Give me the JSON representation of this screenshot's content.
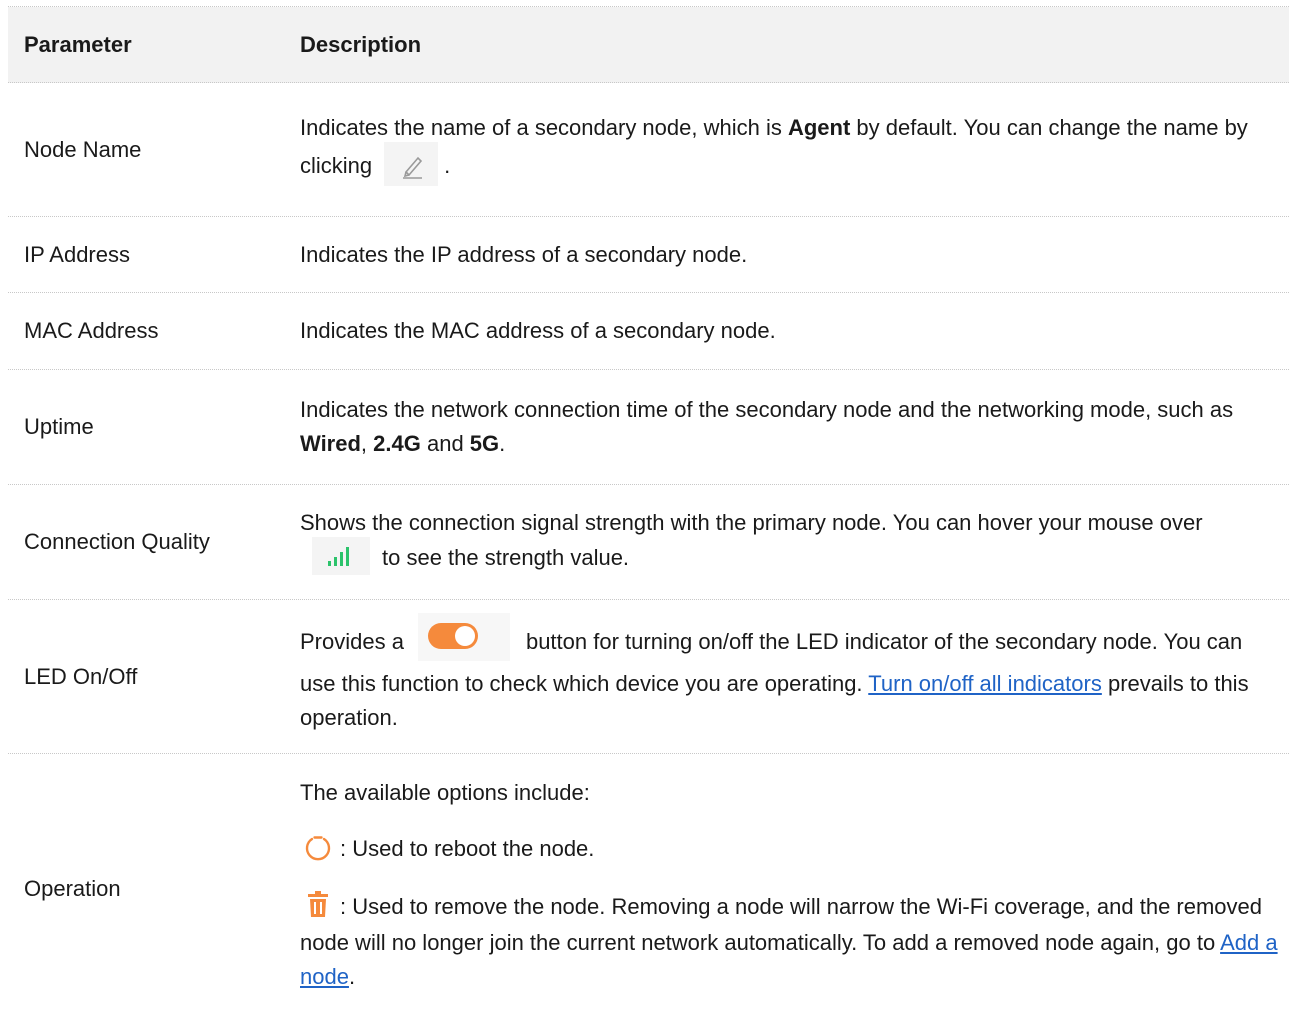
{
  "table": {
    "header": {
      "param": "Parameter",
      "desc": "Description"
    },
    "rows": {
      "node_name": {
        "param": "Node Name",
        "d1": "Indicates the name of a secondary node, which is ",
        "d1_bold": "Agent",
        "d2": " by default. You can change the name by clicking",
        "d3": "."
      },
      "ip_address": {
        "param": "IP Address",
        "desc": "Indicates the IP address of a secondary node."
      },
      "mac_address": {
        "param": "MAC Address",
        "desc": "Indicates the MAC address of a secondary node."
      },
      "uptime": {
        "param": "Uptime",
        "d1": "Indicates the network connection time of the secondary node and the networking mode, such as ",
        "b1": "Wired",
        "sep1": ", ",
        "b2": "2.4G",
        "sep2": " and ",
        "b3": "5G",
        "d2": "."
      },
      "connection_quality": {
        "param": "Connection Quality",
        "d1": "Shows the connection signal strength with the primary node. You can hover your mouse over",
        "d2": "to see the strength value."
      },
      "led": {
        "param": "LED On/Off",
        "d1": "Provides a",
        "d2": "button for turning on/off the LED indicator of the secondary node. You can use this function to check which device you are operating. ",
        "link": "Turn on/off all indicators",
        "d3": " prevails to this operation."
      },
      "operation": {
        "param": "Operation",
        "intro": "The available options include:",
        "reboot": ": Used to reboot the node.",
        "remove_text": ": Used to remove the node. Removing a node will narrow the Wi-Fi coverage, and the removed node will no longer join the current network automatically. To add a removed node again, go to ",
        "remove_link": "Add a node",
        "remove_end": "."
      }
    }
  },
  "icons": {
    "edit": "pencil-icon",
    "signal": "signal-bars-icon",
    "toggle": "toggle-switch-icon",
    "reboot": "power-icon",
    "remove": "trash-icon"
  },
  "colors": {
    "accent_orange": "#f58a3c",
    "signal_green": "#2cc36b",
    "link_blue": "#1f63c6",
    "header_bg": "#f2f2f2"
  }
}
